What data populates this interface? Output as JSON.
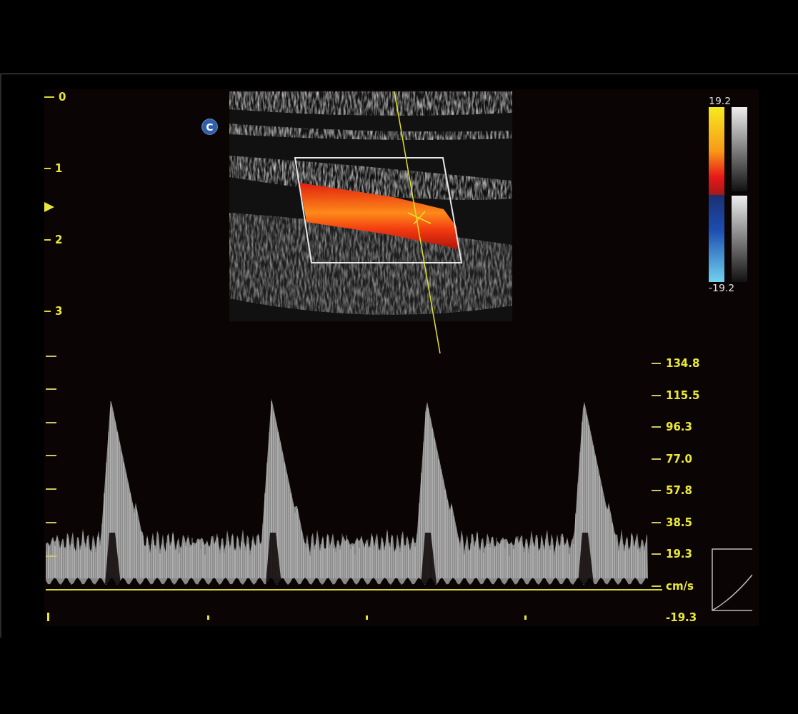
{
  "depth_scale": {
    "labels": [
      "0",
      "1",
      "2",
      "3"
    ]
  },
  "mode_badge": "C",
  "color_scale": {
    "max": "19.2",
    "min": "-19.2"
  },
  "velocity_scale": {
    "labels": [
      "134.8",
      "115.5",
      "96.3",
      "77.0",
      "57.8",
      "38.5",
      "19.3"
    ],
    "unit": "cm/s",
    "min": "-19.3"
  }
}
